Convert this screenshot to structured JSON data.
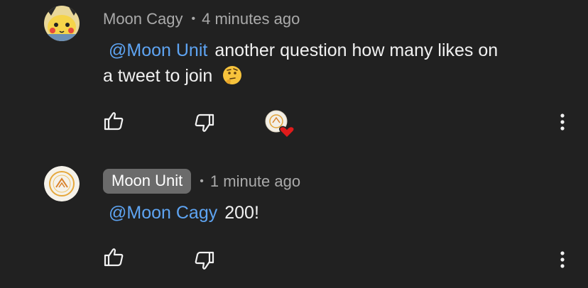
{
  "comments": [
    {
      "author": "Moon Cagy",
      "separator": "•",
      "time": "4 minutes ago",
      "mention": "@Moon Unit",
      "text_line1": "another question how many likes on",
      "text_line2": "a tweet to join",
      "avatar_icon": "pikachu-avatar",
      "emoji_icon": "thinking-face-emoji",
      "creator_heart": true
    },
    {
      "author": "Moon Unit",
      "separator": "•",
      "time": "1 minute ago",
      "mention": "@Moon Cagy",
      "text": "200!",
      "avatar_icon": "moon-unit-logo-avatar",
      "is_creator": true
    }
  ],
  "icons": {
    "like": "thumbs-up-icon",
    "dislike": "thumbs-down-icon",
    "more": "more-vertical-icon",
    "heart": "heart-icon"
  },
  "colors": {
    "background": "#212121",
    "mention": "#5ea4f2",
    "meta": "#aaaaaa",
    "text": "#f1f1f1",
    "chip": "#6b6b6b",
    "heart": "#e01b1b"
  }
}
